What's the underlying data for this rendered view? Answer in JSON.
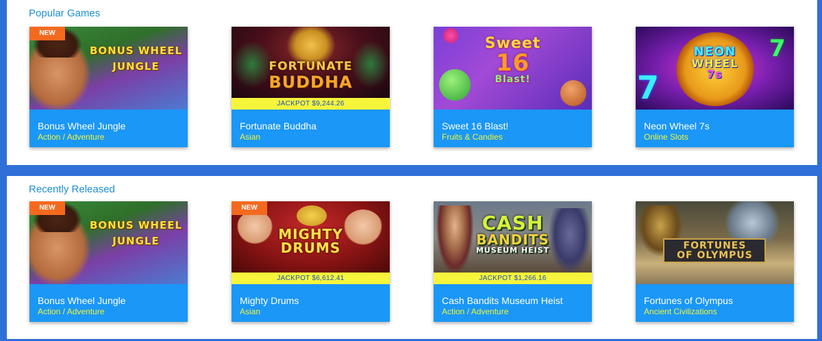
{
  "sections": [
    {
      "title": "Popular Games",
      "cards": [
        {
          "badge": "NEW",
          "logo": [
            "BONUS WHEEL",
            "JUNGLE"
          ],
          "jackpot": "",
          "name": "Bonus Wheel Jungle",
          "category": "Action / Adventure"
        },
        {
          "badge": "",
          "logo": [
            "FORTUNATE",
            "BUDDHA"
          ],
          "jackpot": "JACKPOT $9,244.26",
          "name": "Fortunate Buddha",
          "category": "Asian"
        },
        {
          "badge": "",
          "logo": [
            "Sweet",
            "16",
            "Blast!"
          ],
          "jackpot": "",
          "name": "Sweet 16 Blast!",
          "category": "Fruits & Candies"
        },
        {
          "badge": "",
          "logo": [
            "NEON",
            "WHEEL",
            "7s"
          ],
          "jackpot": "",
          "name": "Neon Wheel 7s",
          "category": "Online Slots"
        }
      ]
    },
    {
      "title": "Recently Released",
      "cards": [
        {
          "badge": "NEW",
          "logo": [
            "BONUS WHEEL",
            "JUNGLE"
          ],
          "jackpot": "",
          "name": "Bonus Wheel Jungle",
          "category": "Action / Adventure"
        },
        {
          "badge": "NEW",
          "logo": [
            "MIGHTY",
            "DRUMS"
          ],
          "jackpot": "JACKPOT $6,612.41",
          "name": "Mighty Drums",
          "category": "Asian"
        },
        {
          "badge": "",
          "logo": [
            "CASH",
            "BANDITS",
            "MUSEUM HEIST"
          ],
          "jackpot": "JACKPOT $1,266.16",
          "name": "Cash Bandits Museum Heist",
          "category": "Action / Adventure"
        },
        {
          "badge": "",
          "logo": [
            "FORTUNES",
            "OF OLYMPUS"
          ],
          "jackpot": "",
          "name": "Fortunes of Olympus",
          "category": "Ancient Civilizations"
        }
      ]
    }
  ]
}
